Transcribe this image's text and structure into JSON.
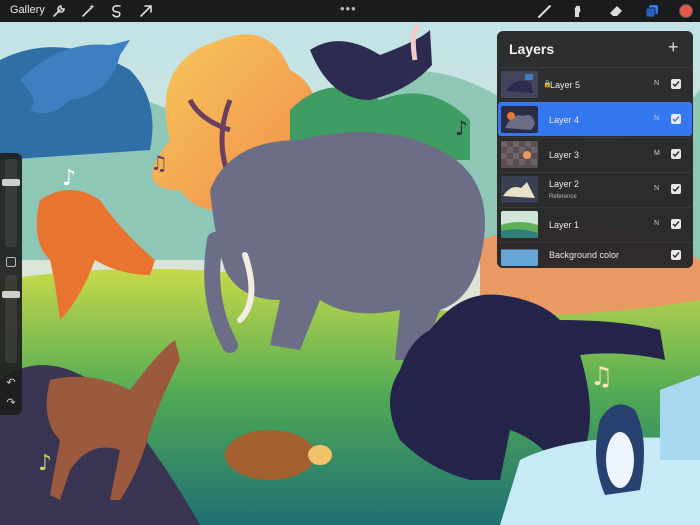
{
  "toolbar": {
    "gallery_label": "Gallery",
    "more_label": "•••",
    "icons": [
      "wrench-icon",
      "magic-wand-icon",
      "selection-icon",
      "transform-arrow-icon",
      "brush-icon",
      "smudge-icon",
      "eraser-icon",
      "layers-icon"
    ],
    "active_color": "#e8584a",
    "active_tool_color": "#3477f0"
  },
  "layers": {
    "title": "Layers",
    "add_label": "+",
    "items": [
      {
        "name": "Layer 5",
        "mode": "N",
        "sub": "",
        "locked": true,
        "active": false,
        "visible": true
      },
      {
        "name": "Layer 4",
        "mode": "N",
        "sub": "",
        "locked": false,
        "active": true,
        "visible": true
      },
      {
        "name": "Layer 3",
        "mode": "M",
        "sub": "",
        "locked": false,
        "active": false,
        "visible": true
      },
      {
        "name": "Layer 2",
        "mode": "N",
        "sub": "Reference",
        "locked": false,
        "active": false,
        "visible": true
      },
      {
        "name": "Layer 1",
        "mode": "N",
        "sub": "",
        "locked": false,
        "active": false,
        "visible": true
      },
      {
        "name": "Background color",
        "mode": "",
        "sub": "",
        "locked": false,
        "active": false,
        "visible": true
      }
    ]
  },
  "sidebar": {
    "brush_size": 0.75,
    "opacity": 0.8,
    "undo_label": "↶",
    "redo_label": "↷"
  }
}
